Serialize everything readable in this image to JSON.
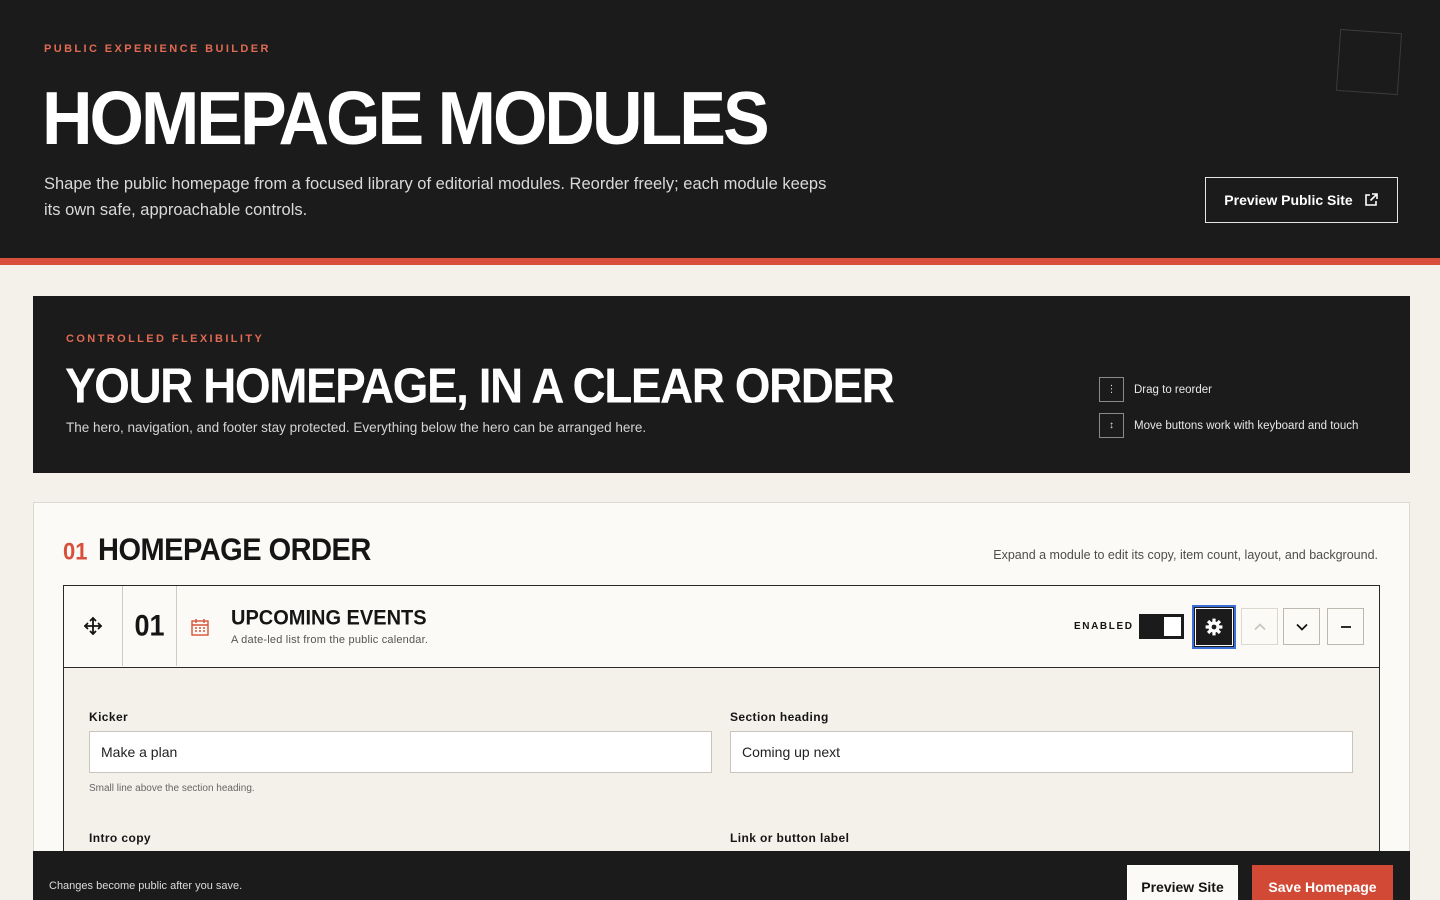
{
  "header": {
    "eyebrow": "PUBLIC EXPERIENCE BUILDER",
    "title": "HOMEPAGE MODULES",
    "description": "Shape the public homepage from a focused library of editorial modules. Reorder freely; each module keeps its own safe, approachable controls.",
    "preview_label": "Preview Public Site",
    "preview_icon": "external-link-icon"
  },
  "banner": {
    "eyebrow": "CONTROLLED FLEXIBILITY",
    "title": "YOUR HOMEPAGE, IN A CLEAR ORDER",
    "description": "The hero, navigation, and footer stay protected. Everything below the hero can be arranged here.",
    "hints": [
      {
        "icon": "drag-handle-icon",
        "label": "Drag to reorder"
      },
      {
        "icon": "move-arrows-icon",
        "label": "Move buttons work with keyboard and touch"
      }
    ]
  },
  "order_panel": {
    "number": "01",
    "title": "HOMEPAGE ORDER",
    "hint": "Expand a module to edit its copy, item count, layout, and background.",
    "module": {
      "number": "01",
      "icon": "calendar-icon",
      "title": "UPCOMING EVENTS",
      "subtitle": "A date-led list from the public calendar.",
      "enabled_label": "ENABLED",
      "enabled": true,
      "fields": {
        "kicker_label": "Kicker",
        "kicker_value": "Make a plan",
        "kicker_help": "Small line above the section heading.",
        "heading_label": "Section heading",
        "heading_value": "Coming up next",
        "intro_label": "Intro copy",
        "link_label": "Link or button label"
      }
    }
  },
  "save_bar": {
    "message": "Changes become public after you save.",
    "preview_label": "Preview Site",
    "save_label": "Save Homepage"
  },
  "colors": {
    "accent": "#d8503b",
    "dark": "#1b1b1b",
    "page_bg": "#f4f1ea",
    "focus": "#3b6fd8"
  }
}
